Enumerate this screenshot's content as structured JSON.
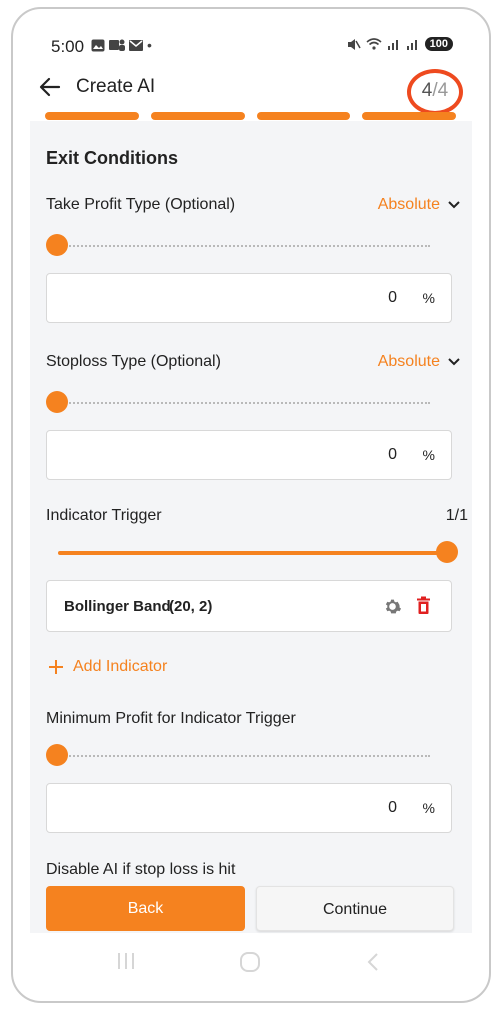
{
  "status_bar": {
    "time": "5:00",
    "battery": "100"
  },
  "header": {
    "title": "Create AI",
    "step_current": "4",
    "step_separator": "/",
    "step_total": "4"
  },
  "progress_steps": 4,
  "section_title": "Exit Conditions",
  "take_profit": {
    "label": "Take Profit Type (Optional)",
    "type": "Absolute",
    "slider_value": 0,
    "value": "0",
    "unit": "%"
  },
  "stoploss": {
    "label": "Stoploss Type (Optional)",
    "type": "Absolute",
    "slider_value": 0,
    "value": "0",
    "unit": "%"
  },
  "indicator_trigger": {
    "label": "Indicator Trigger",
    "count": "1/1",
    "slider_value": 1
  },
  "indicators": [
    {
      "name": "Bollinger Band",
      "params": "(20, 2)"
    }
  ],
  "add_indicator_label": "Add Indicator",
  "min_profit": {
    "label": "Minimum Profit for Indicator Trigger",
    "slider_value": 0,
    "value": "0",
    "unit": "%"
  },
  "disable_ai_label": "Disable AI if stop loss is hit",
  "buttons": {
    "back": "Back",
    "continue": "Continue"
  },
  "colors": {
    "accent": "#f5821f",
    "highlight_ring": "#ee4a1f",
    "delete": "#e02020"
  },
  "icons": [
    "back-arrow-icon",
    "chevron-down-icon",
    "gear-icon",
    "trash-icon",
    "plus-icon",
    "recent-apps-icon",
    "home-icon",
    "back-nav-icon"
  ]
}
